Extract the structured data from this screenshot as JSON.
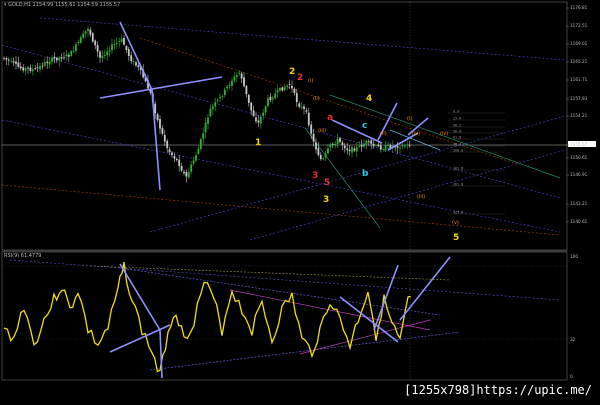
{
  "price_header": {
    "text": "GOLD,H1  1154.99 1155.61 1154.59 1155.57"
  },
  "rsi_header": {
    "text": "RSI(9) 61.4779"
  },
  "price_axis": [
    "1176.81",
    "1172.51",
    "1169.01",
    "1165.21",
    "1161.71",
    "1157.93",
    "1155.57",
    "1154.21",
    "1150.61",
    "1146.91",
    "1143.21",
    "1140.61"
  ],
  "rsi_axis": [
    "100",
    "32",
    "0"
  ],
  "wave_labels": {
    "w1": "1",
    "w2": "2",
    "w2r": "2",
    "w3": "3",
    "w3r": "3",
    "w4": "4",
    "w5": "5",
    "w5r": "5",
    "a": "a",
    "b": "b",
    "c": "c",
    "ri": "(i)",
    "rii": "(ii)",
    "riii": "(iii)",
    "riv": "(iv)",
    "rv": "(v)",
    "ri2": "(i)",
    "rii2": "(ii)",
    "riii2": "(iii)",
    "riv2": "(iv)"
  },
  "fib_levels": [
    "0.0",
    "23.6",
    "38.2",
    "50.0",
    "61.8",
    "76.4",
    "100.0",
    "161.8",
    "261.8",
    "423.6"
  ],
  "watermark": "[1255x798]https://upic.me/",
  "colors": {
    "bull": "#34b233",
    "bear": "#c8c8c8",
    "rsi": "#f0e010",
    "trend": "#8f8fff",
    "wave_yellow": "#f4d400",
    "wave_red": "#e83030",
    "wave_orange": "#ff8c00",
    "wave_cyan": "#22c8e8"
  }
}
